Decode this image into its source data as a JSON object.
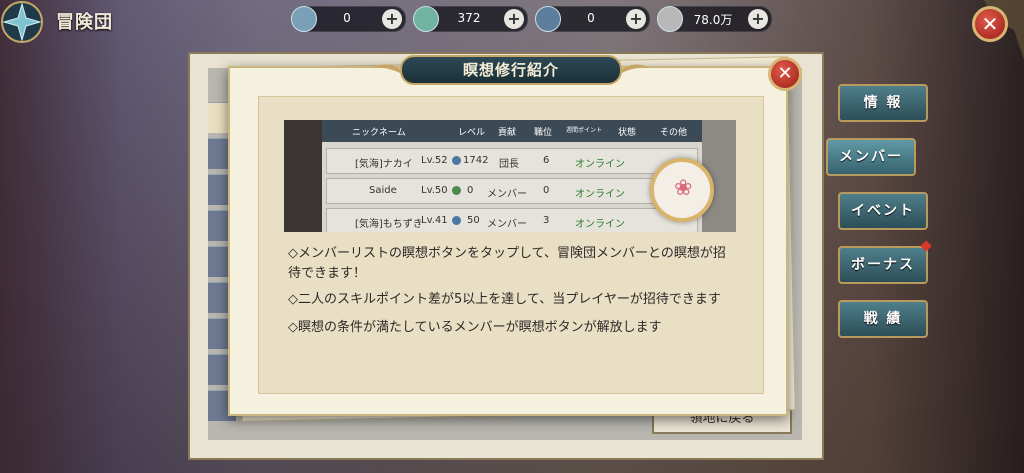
{
  "header": {
    "title": "冒険団",
    "resources": [
      {
        "icon": "feather-icon",
        "value": "0"
      },
      {
        "icon": "crystal-icon",
        "value": "372"
      },
      {
        "icon": "coin-badge-icon",
        "value": "0"
      },
      {
        "icon": "silver-coin-icon",
        "value": "78.0万"
      }
    ]
  },
  "side_tabs": [
    {
      "label": "情 報"
    },
    {
      "label": "メンバー"
    },
    {
      "label": "イベント"
    },
    {
      "label": "ボーナス"
    },
    {
      "label": "戦 績"
    }
  ],
  "background_window": {
    "return_button": "領地に戻る"
  },
  "modal": {
    "title": "瞑想修行紹介",
    "preview": {
      "headers": [
        "ニックネーム",
        "レベル",
        "貢献",
        "職位",
        "週間ポイント",
        "状態",
        "その他"
      ],
      "rows": [
        {
          "name": "[気海]ナカイ",
          "level": "Lv.52",
          "contribution": "1742",
          "role": "団長",
          "points": "6",
          "status": "オンライン"
        },
        {
          "name": "Saide",
          "level": "Lv.50",
          "contribution": "0",
          "role": "メンバー",
          "points": "0",
          "status": "オンライン"
        },
        {
          "name": "[気海]もちずき",
          "level": "Lv.41",
          "contribution": "50",
          "role": "メンバー",
          "points": "3",
          "status": "オンライン"
        }
      ]
    },
    "lines": [
      "◇メンバーリストの瞑想ボタンをタップして、冒険団メンバーとの瞑想が招",
      "待できます！",
      "◇二人のスキルポイント差が5以上を達して、当プレイヤーが招待できます",
      "◇瞑想の条件が満たしているメンバーが瞑想ボタンが解放します"
    ]
  }
}
